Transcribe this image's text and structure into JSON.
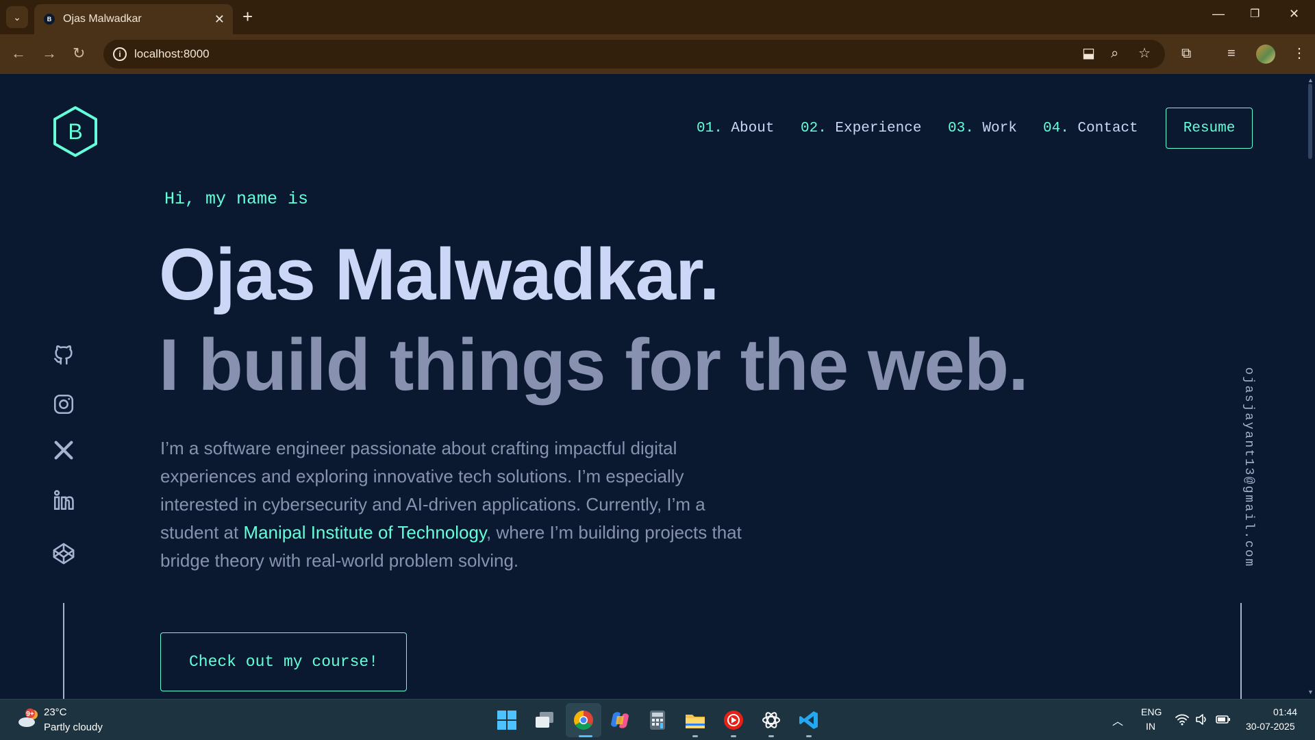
{
  "browser": {
    "tab_title": "Ojas Malwadkar",
    "favicon_letter": "B",
    "url": "localhost:8000"
  },
  "page": {
    "logo_letter": "B",
    "nav": [
      {
        "num": "01.",
        "label": "About"
      },
      {
        "num": "02.",
        "label": "Experience"
      },
      {
        "num": "03.",
        "label": "Work"
      },
      {
        "num": "04.",
        "label": "Contact"
      }
    ],
    "resume_label": "Resume",
    "greeting": "Hi, my name is",
    "name": "Ojas Malwadkar.",
    "tagline": "I build things for the web.",
    "bio": {
      "part1": "I’m a software engineer passionate about crafting impactful digital experiences and exploring innovative tech solutions. I’m especially interested in cybersecurity and AI-driven applications. Currently, I’m a student at ",
      "highlight": "Manipal Institute of Technology",
      "part2": ", where I’m building projects that bridge theory with real-world problem solving."
    },
    "cta_label": "Check out my course!",
    "email": "ojasjayant13@gmail.com",
    "socials": [
      "github-icon",
      "instagram-icon",
      "x-icon",
      "linkedin-icon",
      "codepen-icon"
    ],
    "colors": {
      "background": "#0a192f",
      "accent": "#64ffda",
      "heading": "#ccd6f6",
      "text": "#8892b0"
    }
  },
  "taskbar": {
    "temp": "23°C",
    "condition": "Partly cloudy",
    "weather_badge": "9+",
    "lang1": "ENG",
    "lang2": "IN",
    "time": "01:44",
    "date": "30-07-2025"
  }
}
